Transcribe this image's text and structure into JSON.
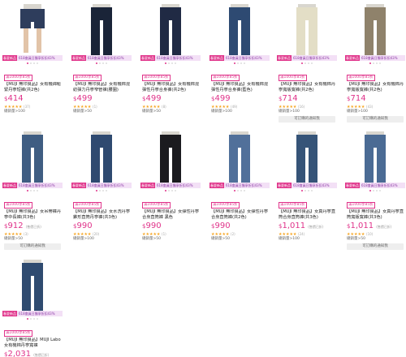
{
  "promo_tag": "春夏新品",
  "promo_text": "618會員日獨享折扣43%",
  "coupon": "滿1000享85折",
  "ship_label": "可訂購的通知我",
  "products": [
    {
      "title": "【MUJI 無印良品】女有機綿鬆緊丹寧短褲(共2色)",
      "price": "414",
      "note": "",
      "rating": "(37)",
      "sales": "總銷量>100",
      "colors": [
        "#2d3a55",
        "#8a6f4b"
      ],
      "ship": false,
      "pant": "#2e3d5c",
      "short": true
    },
    {
      "title": "【MUJI 無印良品】女有機棉混紡彈力丹寧窄管褲(腰圍)",
      "price": "499",
      "note": "",
      "rating": "(1)",
      "sales": "總銷量>50",
      "colors": [
        "#1d2740"
      ],
      "ship": false,
      "pant": "#1a2438",
      "short": false
    },
    {
      "title": "【MUJI 無印良品】女有機棉混彈性丹寧合身褲(共2色)",
      "price": "499",
      "note": "",
      "rating": "(8)",
      "sales": "總銷量>50",
      "colors": [
        "#1d2740"
      ],
      "ship": false,
      "pant": "#202a44",
      "short": false
    },
    {
      "title": "【MUJI 無印良品】女有機棉混彈性丹寧合身褲(藍色)",
      "price": "499",
      "note": "",
      "rating": "(49)",
      "sales": "總銷量>100",
      "colors": [
        "#3b5a86"
      ],
      "ship": false,
      "pant": "#2e4a72",
      "short": false
    },
    {
      "title": "【MUJI 無印良品】女有機棉丹寧寬版寬褲(共2色)",
      "price": "714",
      "note": "",
      "rating": "(16)",
      "sales": "總銷量>100",
      "colors": [
        "#d8d2bc"
      ],
      "ship": true,
      "pant": "#e3dec6",
      "short": false
    },
    {
      "title": "【MUJI 無印良品】女有機棉丹寧寬版寬褲(共2色)",
      "price": "714",
      "note": "",
      "rating": "(43)",
      "sales": "總銷量>100",
      "colors": [
        "#8c7d66"
      ],
      "ship": true,
      "pant": "#8f826b",
      "short": false
    },
    {
      "title": "【MUJI 無印良品】女吊帶褲丹寧中長褲(共3色)",
      "price": "912",
      "note": "(售價已折)",
      "rating": "(3)",
      "sales": "總銷量>50",
      "colors": [
        "#3b5a86"
      ],
      "ship": true,
      "pant": "#3f5d82",
      "short": false
    },
    {
      "title": "【MUJI 無印良品】女水洗丹寧錐形直筒丹寧褲(共3色)",
      "price": "990",
      "note": "",
      "rating": "(20)",
      "sales": "總銷量>100",
      "colors": [
        "#2d4466"
      ],
      "ship": false,
      "pant": "#2f4a70",
      "short": false
    },
    {
      "title": "【MUJI 無印良品】女彈性丹寧合身直筒褲 黑色",
      "price": "990",
      "note": "",
      "rating": "(1)",
      "sales": "總銷量>50",
      "colors": [
        "#1a1a1a"
      ],
      "ship": false,
      "pant": "#1b1b1f",
      "short": false
    },
    {
      "title": "【MUJI 無印良品】女彈性丹寧合身直筒褲(共2色)",
      "price": "990",
      "note": "",
      "rating": "(2)",
      "sales": "總銷量>50",
      "colors": [
        "#4f6f97"
      ],
      "ship": false,
      "pant": "#51709a",
      "short": false
    },
    {
      "title": "【MUJI 無印良品】女真丹寧直筒合身直筒褲(共3色)",
      "price": "1,011",
      "note": "(售價已折)",
      "rating": "(24)",
      "sales": "總銷量>100",
      "colors": [
        "#2d4466"
      ],
      "ship": false,
      "pant": "#365478",
      "short": false
    },
    {
      "title": "【MUJI 無印良品】女真丹寧直筒寬版寬褲(共3色)",
      "price": "1,011",
      "note": "(售價已折)",
      "rating": "(10)",
      "sales": "總銷量>50",
      "colors": [
        "#4a6a93"
      ],
      "ship": true,
      "pant": "#4b6b94",
      "short": false
    },
    {
      "title": "【MUJI 無印良品】MUJI Labo 女有機棉丹寧寬褲",
      "price": "2,031",
      "note": "(售價已折)",
      "rating": "",
      "sales": "",
      "colors": [],
      "ship": false,
      "pant": "#2f4b70",
      "short": false
    }
  ]
}
